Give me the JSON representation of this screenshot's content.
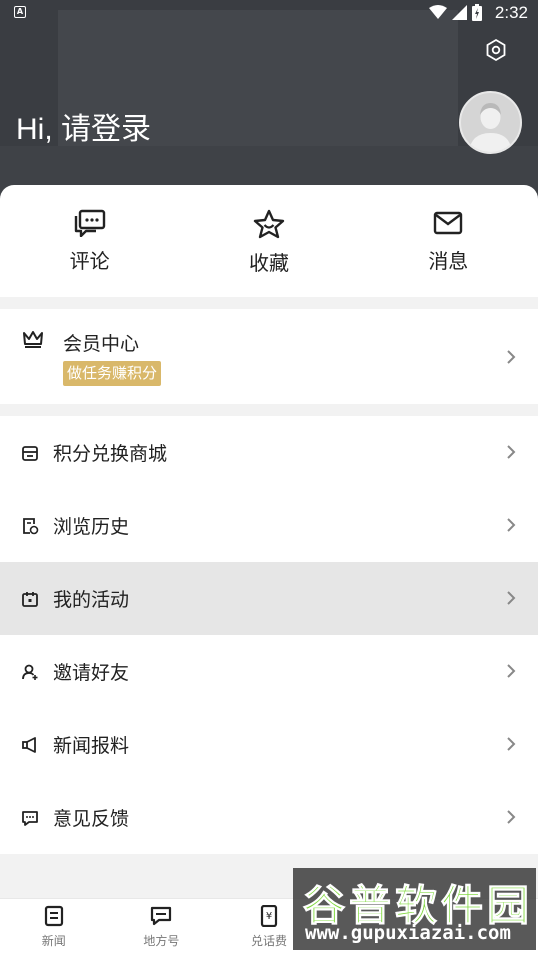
{
  "status_bar": {
    "time": "2:32",
    "notification_icon": "A"
  },
  "header": {
    "greeting": "Hi, 请登录",
    "settings_icon": "settings-icon",
    "avatar_icon": "avatar"
  },
  "quick_actions": [
    {
      "label": "评论",
      "icon": "comment-icon"
    },
    {
      "label": "收藏",
      "icon": "star-icon"
    },
    {
      "label": "消息",
      "icon": "mail-icon"
    }
  ],
  "member": {
    "title": "会员中心",
    "badge": "做任务赚积分"
  },
  "menu": [
    {
      "label": "积分兑换商城",
      "icon": "store-icon"
    },
    {
      "label": "浏览历史",
      "icon": "history-icon"
    },
    {
      "label": "我的活动",
      "icon": "calendar-icon",
      "highlighted": true
    },
    {
      "label": "邀请好友",
      "icon": "invite-user-icon"
    },
    {
      "label": "新闻报料",
      "icon": "megaphone-icon"
    },
    {
      "label": "意见反馈",
      "icon": "feedback-icon"
    }
  ],
  "bottom_nav": [
    {
      "label": "新闻",
      "icon": "news-icon"
    },
    {
      "label": "地方号",
      "icon": "chat-icon"
    },
    {
      "label": "兑话费",
      "icon": "phone-yen-icon"
    }
  ],
  "watermark": {
    "title": "谷普软件园",
    "url": "www.gupuxiazai.com"
  },
  "colors": {
    "header_bg": "#3a3d42",
    "badge_bg": "#d9b86a",
    "active_row": "#e6e6e6"
  }
}
